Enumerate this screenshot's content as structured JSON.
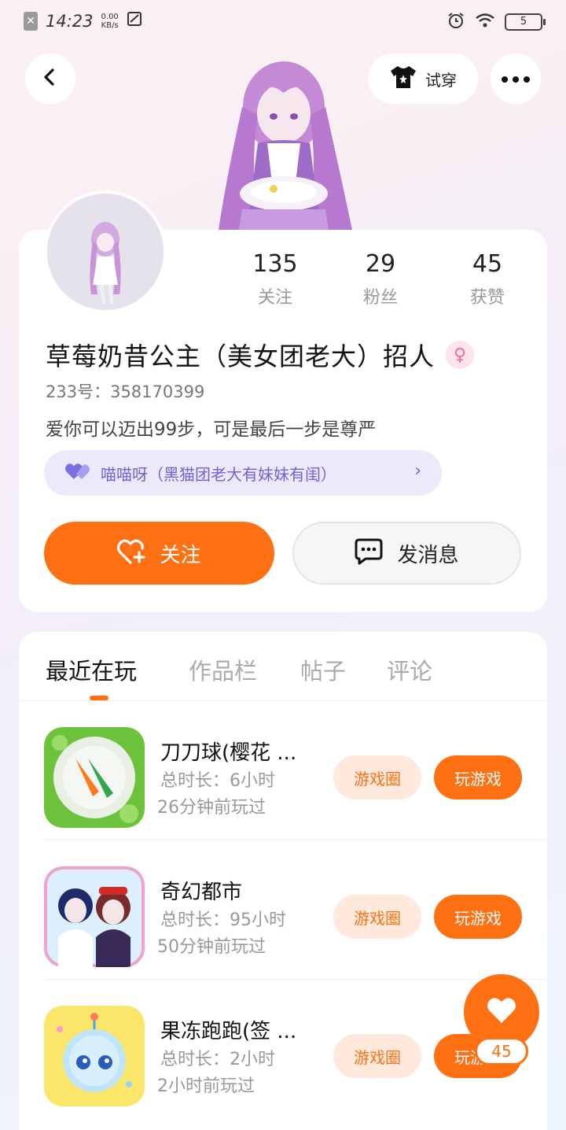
{
  "status_bar": {
    "time": "14:23",
    "speed_value": "0.00",
    "speed_unit": "KB/s",
    "battery": "5"
  },
  "header": {
    "tryon_label": "试穿"
  },
  "profile": {
    "stats": [
      {
        "value": "135",
        "label": "关注"
      },
      {
        "value": "29",
        "label": "粉丝"
      },
      {
        "value": "45",
        "label": "获赞"
      }
    ],
    "name": "草莓奶昔公主（美女团老大）招人",
    "gender_symbol": "♀",
    "user_id": "233号：358170399",
    "bio": "爱你可以迈出99步，可是最后一步是尊严",
    "group_chip": "喵喵呀（黑猫团老大有妹妹有闺）",
    "follow_label": "关注",
    "message_label": "发消息"
  },
  "tabs": [
    {
      "label": "最近在玩",
      "active": true
    },
    {
      "label": "作品栏",
      "active": false
    },
    {
      "label": "帖子",
      "active": false
    },
    {
      "label": "评论",
      "active": false
    }
  ],
  "games": [
    {
      "title": "刀刀球(樱花 ...",
      "duration": "总时长：6小时",
      "last_played": "26分钟前玩过",
      "circle_label": "游戏圈",
      "play_label": "玩游戏",
      "icon": "knife-ball-icon"
    },
    {
      "title": "奇幻都市",
      "duration": "总时长：95小时",
      "last_played": "50分钟前玩过",
      "circle_label": "游戏圈",
      "play_label": "玩游戏",
      "icon": "fantasy-city-icon"
    },
    {
      "title": "果冻跑跑(签 ...",
      "duration": "总时长：2小时",
      "last_played": "2小时前玩过",
      "circle_label": "游戏圈",
      "play_label": "玩游戏",
      "icon": "jelly-run-icon"
    }
  ],
  "like_fab": {
    "count": "45"
  },
  "colors": {
    "accent": "#ff7012",
    "chip_bg": "#ece9fb",
    "chip_text": "#6e63d6"
  }
}
